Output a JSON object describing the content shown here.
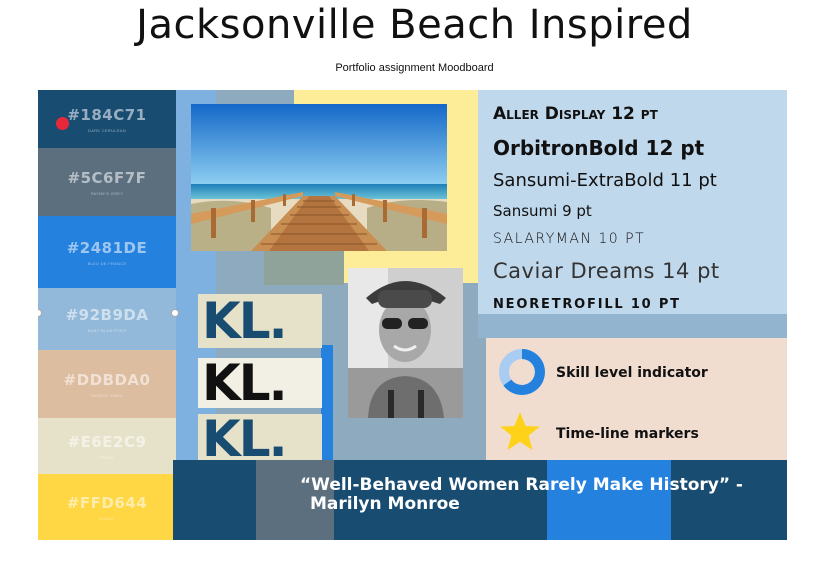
{
  "header": {
    "title": "Jacksonville Beach Inspired",
    "subtitle": "Portfolio assignment Moodboard"
  },
  "palette": [
    {
      "hex": "#184C71",
      "name": "DARK CERULEAN",
      "color": "#184c71"
    },
    {
      "hex": "#5C6F7F",
      "name": "PAYNE'S GREY",
      "color": "#5c6f7f"
    },
    {
      "hex": "#2481DE",
      "name": "BLEU DE FRANCE",
      "color": "#2481de"
    },
    {
      "hex": "#92B9DA",
      "name": "BABY BLUE EYES",
      "color": "#92b9da"
    },
    {
      "hex": "#DDBDA0",
      "name": "DESERT SAND",
      "color": "#ddbda0"
    },
    {
      "hex": "#E6E2C9",
      "name": "PEARL",
      "color": "#e6e2c9"
    },
    {
      "hex": "#FFD644",
      "name": "SUNNY",
      "color": "#ffd644"
    }
  ],
  "fonts": [
    {
      "label": "Aller Display 12 pt"
    },
    {
      "label": "OrbitronBold 12 pt"
    },
    {
      "label": "Sansumi-ExtraBold 11 pt"
    },
    {
      "label": "Sansumi 9 pt"
    },
    {
      "label": "SALARYMAN 10 PT"
    },
    {
      "label": "Caviar Dreams 14 pt"
    },
    {
      "label": "NEORETROFILL 10 PT"
    }
  ],
  "logos": [
    "KL.",
    "KL.",
    "KL."
  ],
  "legend": {
    "skill": "Skill level indicator",
    "timeline": "Time-line markers"
  },
  "quote": {
    "line1": "“Well-Behaved Women Rarely Make History”  -",
    "line2": "Marilyn Monroe"
  },
  "colors": {
    "accent_red": "#e8283a",
    "star": "#ffd21a",
    "ring": "#2481de"
  },
  "icons": [
    "red-dot-icon",
    "donut-chart-icon",
    "star-icon"
  ]
}
